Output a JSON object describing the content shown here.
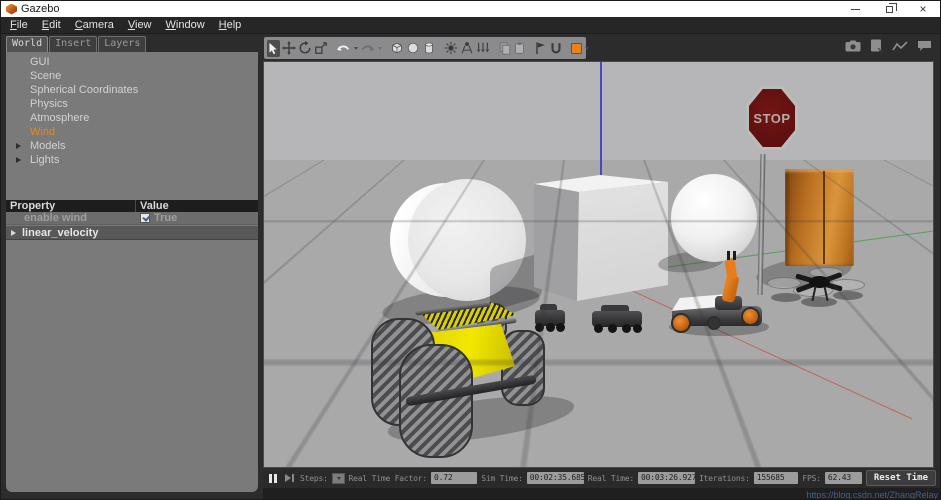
{
  "window": {
    "title": "Gazebo",
    "controls": [
      "minimize",
      "restore",
      "close"
    ]
  },
  "menu": {
    "items": [
      "File",
      "Edit",
      "Camera",
      "View",
      "Window",
      "Help"
    ]
  },
  "left_panel": {
    "tabs": [
      {
        "label": "World",
        "active": true
      },
      {
        "label": "Insert",
        "active": false
      },
      {
        "label": "Layers",
        "active": false
      }
    ],
    "tree": [
      {
        "label": "GUI"
      },
      {
        "label": "Scene"
      },
      {
        "label": "Spherical Coordinates"
      },
      {
        "label": "Physics"
      },
      {
        "label": "Atmosphere"
      },
      {
        "label": "Wind",
        "highlighted": true
      },
      {
        "label": "Models",
        "expandable": true
      },
      {
        "label": "Lights",
        "expandable": true
      }
    ],
    "properties": {
      "header": {
        "property": "Property",
        "value": "Value"
      },
      "rows": [
        {
          "name": "enable wind",
          "value": "True",
          "checked": true
        }
      ],
      "group": "linear_velocity"
    }
  },
  "toolbar": {
    "tools": [
      "select",
      "translate",
      "rotate",
      "scale",
      "undo",
      "redo",
      "box",
      "sphere",
      "cylinder",
      "point-light",
      "spot-light",
      "directional-light",
      "copy",
      "paste",
      "align",
      "snap",
      "view-angle"
    ],
    "active_tool": "select"
  },
  "top_right_tools": [
    "screenshot",
    "log-record",
    "plot",
    "feedback"
  ],
  "viewport": {
    "stop_sign": {
      "text": "STOP"
    }
  },
  "statusbar": {
    "steps_label": "Steps:",
    "rtf_label": "Real Time Factor:",
    "rtf_value": "0.72",
    "sim_time_label": "Sim Time:",
    "sim_time_value": "00:02:35.685",
    "real_time_label": "Real Time:",
    "real_time_value": "00:03:26.927",
    "iterations_label": "Iterations:",
    "iterations_value": "155685",
    "fps_label": "FPS:",
    "fps_value": "62.43",
    "reset_button": "Reset Time"
  },
  "watermark": "https://blog.csdn.net/ZhangRelay",
  "colors": {
    "wind_highlight": "#e8891c",
    "accent_orange": "#e8821e",
    "viewport_sky": "#b6b6b8",
    "viewport_ground": "#a9a9aa",
    "stop_sign_red": "#5c0f0f",
    "husky_yellow": "#f2e800",
    "watermark_blue": "#44608c"
  }
}
